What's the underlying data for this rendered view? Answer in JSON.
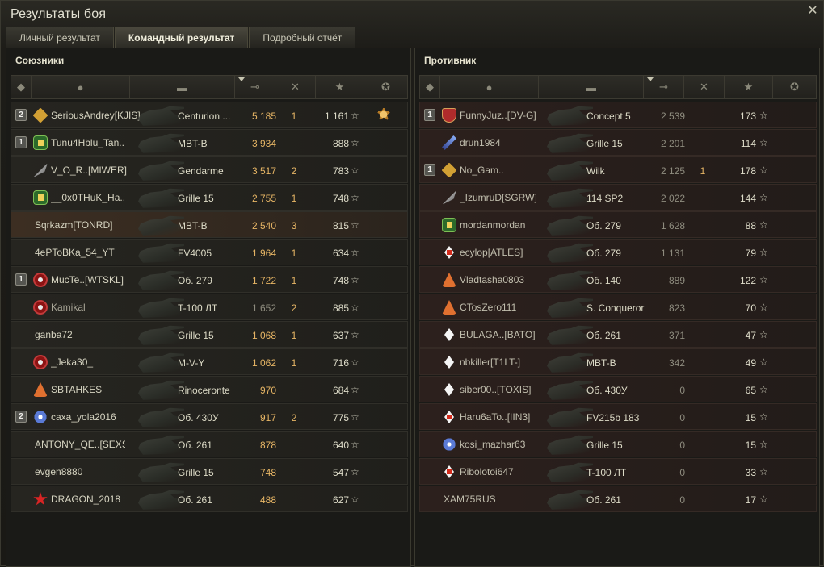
{
  "window": {
    "title": "Результаты боя",
    "close_icon": "close-icon"
  },
  "tabs": [
    {
      "label": "Личный результат",
      "active": false
    },
    {
      "label": "Командный результат",
      "active": true
    },
    {
      "label": "Подробный отчёт",
      "active": false
    }
  ],
  "columns": [
    "squad-icon",
    "player-icon",
    "tank-icon",
    "damage-icon",
    "kills-icon",
    "xp-star-icon",
    "medal-icon"
  ],
  "allies": {
    "title": "Союзники",
    "rows": [
      {
        "squad": "2",
        "badge": "gold",
        "name": "SeriousAndrey[KJIS]",
        "tank": "Centurion ...",
        "damage": "5 185",
        "kills": "1",
        "xp": "1 161",
        "medal": true
      },
      {
        "squad": "1",
        "badge": "green",
        "name": "Tunu4Hblu_Tan..",
        "tank": "MBT-B",
        "damage": "3 934",
        "kills": "",
        "xp": "888"
      },
      {
        "squad": "",
        "badge": "feather",
        "name": "V_O_R..[MIWER]",
        "tank": "Gendarme",
        "damage": "3 517",
        "kills": "2",
        "xp": "783"
      },
      {
        "squad": "",
        "badge": "green",
        "name": "__0x0THuK_Ha..",
        "tank": "Grille 15",
        "damage": "2 755",
        "kills": "1",
        "xp": "748"
      },
      {
        "squad": "",
        "badge": "none",
        "name": "Sqrkazm[TONRD]",
        "tank": "MBT-B",
        "damage": "2 540",
        "kills": "3",
        "xp": "815",
        "me": true
      },
      {
        "squad": "",
        "badge": "none",
        "name": "4ePToBKa_54_YT",
        "tank": "FV4005",
        "damage": "1 964",
        "kills": "1",
        "xp": "634"
      },
      {
        "squad": "1",
        "badge": "red",
        "name": "MucTe..[WTSKL]",
        "tank": "Об. 279",
        "damage": "1 722",
        "kills": "1",
        "xp": "748"
      },
      {
        "squad": "",
        "badge": "red",
        "name": "Kamikal",
        "tank": "T-100 ЛТ",
        "damage": "1 652",
        "kills": "2",
        "xp": "885",
        "dim": true
      },
      {
        "squad": "",
        "badge": "none",
        "name": "ganba72",
        "tank": "Grille 15",
        "damage": "1 068",
        "kills": "1",
        "xp": "637"
      },
      {
        "squad": "",
        "badge": "red",
        "name": "_Jeka30_",
        "tank": "M-V-Y",
        "damage": "1 062",
        "kills": "1",
        "xp": "716"
      },
      {
        "squad": "",
        "badge": "orange",
        "name": "SBTAHKES",
        "tank": "Rinoceronte",
        "damage": "970",
        "kills": "",
        "xp": "684"
      },
      {
        "squad": "2",
        "badge": "snow",
        "name": "caxa_yola2016",
        "tank": "Об. 430У",
        "damage": "917",
        "kills": "2",
        "xp": "775"
      },
      {
        "squad": "",
        "badge": "none",
        "name": "ANTONY_QE..[SEXSI]",
        "tank": "Об. 261",
        "damage": "878",
        "kills": "",
        "xp": "640"
      },
      {
        "squad": "",
        "badge": "none",
        "name": "evgen8880",
        "tank": "Grille 15",
        "damage": "748",
        "kills": "",
        "xp": "547"
      },
      {
        "squad": "",
        "badge": "star",
        "name": "DRAGON_2018",
        "tank": "Об. 261",
        "damage": "488",
        "kills": "",
        "xp": "627"
      }
    ]
  },
  "enemies": {
    "title": "Противник",
    "rows": [
      {
        "squad": "1",
        "badge": "shield",
        "name": "FunnyJuz..[DV-G]",
        "tank": "Concept 5",
        "damage": "2 539",
        "kills": "",
        "xp": "173"
      },
      {
        "squad": "",
        "badge": "sword",
        "name": "drun1984",
        "tank": "Grille 15",
        "damage": "2 201",
        "kills": "",
        "xp": "114"
      },
      {
        "squad": "1",
        "badge": "gold",
        "name": "No_Gam..",
        "tank": "Wilk",
        "damage": "2 125",
        "kills": "1",
        "xp": "178"
      },
      {
        "squad": "",
        "badge": "feather",
        "name": "_IzumruD[SGRW]",
        "tank": "114 SP2",
        "damage": "2 022",
        "kills": "",
        "xp": "144"
      },
      {
        "squad": "",
        "badge": "green",
        "name": "mordanmordan",
        "tank": "Об. 279",
        "damage": "1 628",
        "kills": "",
        "xp": "88"
      },
      {
        "squad": "",
        "badge": "diamond-red",
        "name": "ecylop[ATLES]",
        "tank": "Об. 279",
        "damage": "1 131",
        "kills": "",
        "xp": "79"
      },
      {
        "squad": "",
        "badge": "orange",
        "name": "Vladtasha0803",
        "tank": "Об. 140",
        "damage": "889",
        "kills": "",
        "xp": "122"
      },
      {
        "squad": "",
        "badge": "orange",
        "name": "CTosZero111",
        "tank": "S. Conqueror",
        "damage": "823",
        "kills": "",
        "xp": "70"
      },
      {
        "squad": "",
        "badge": "diamond",
        "name": "BULAGA..[BATO]",
        "tank": "Об. 261",
        "damage": "371",
        "kills": "",
        "xp": "47"
      },
      {
        "squad": "",
        "badge": "diamond",
        "name": "nbkiller[T1LT-]",
        "tank": "MBT-B",
        "damage": "342",
        "kills": "",
        "xp": "49"
      },
      {
        "squad": "",
        "badge": "diamond",
        "name": "siber00..[TOXIS]",
        "tank": "Об. 430У",
        "damage": "0",
        "kills": "",
        "xp": "65"
      },
      {
        "squad": "",
        "badge": "diamond-red",
        "name": "Haru6aTo..[IIN3]",
        "tank": "FV215b 183",
        "damage": "0",
        "kills": "",
        "xp": "15"
      },
      {
        "squad": "",
        "badge": "snow",
        "name": "kosi_mazhar63",
        "tank": "Grille 15",
        "damage": "0",
        "kills": "",
        "xp": "15"
      },
      {
        "squad": "",
        "badge": "diamond-red",
        "name": "Ribolotoi647",
        "tank": "T-100 ЛТ",
        "damage": "0",
        "kills": "",
        "xp": "33"
      },
      {
        "squad": "",
        "badge": "none",
        "name": "XAM75RUS",
        "tank": "Об. 261",
        "damage": "0",
        "kills": "",
        "xp": "17"
      }
    ]
  }
}
